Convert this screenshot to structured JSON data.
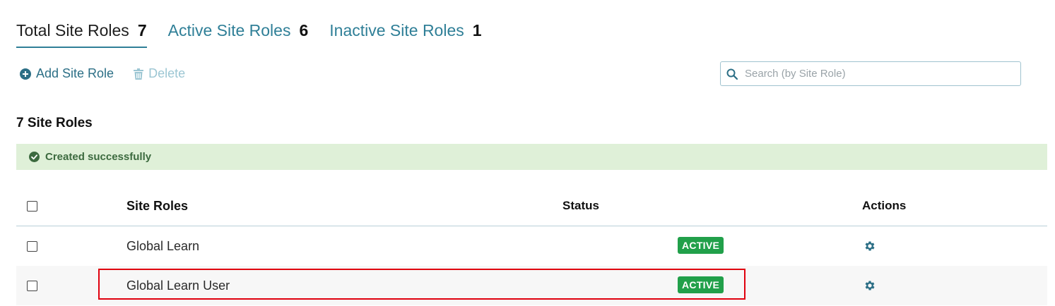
{
  "tabs": [
    {
      "label": "Total Site Roles",
      "count": "7"
    },
    {
      "label": "Active Site Roles",
      "count": "6"
    },
    {
      "label": "Inactive Site Roles",
      "count": "1"
    }
  ],
  "toolbar": {
    "add_label": "Add Site Role",
    "delete_label": "Delete"
  },
  "search": {
    "placeholder": "Search (by Site Role)",
    "value": ""
  },
  "roles_heading": "7 Site Roles",
  "alert": {
    "message": "Created successfully"
  },
  "table": {
    "headers": {
      "name": "Site Roles",
      "status": "Status",
      "actions": "Actions"
    },
    "rows": [
      {
        "name": "Global Learn",
        "status": "ACTIVE"
      },
      {
        "name": "Global Learn User",
        "status": "ACTIVE"
      }
    ]
  },
  "colors": {
    "accent": "#2f7f97",
    "badge_active": "#21a04a",
    "alert_bg": "#dff0d8",
    "highlight": "#e0000e"
  }
}
